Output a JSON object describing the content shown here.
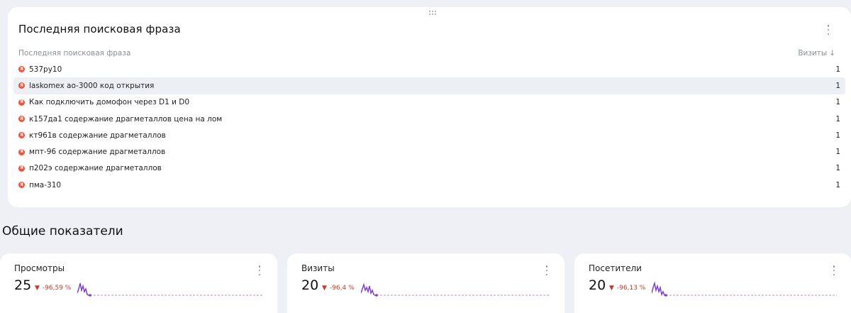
{
  "search_card": {
    "title": "Последняя поисковая фраза",
    "col_phrase": "Последняя поисковая фраза",
    "col_visits": "Визиты",
    "sort_arrow": "↓",
    "source_icon": "yandex-icon",
    "source_icon_letter": "Я",
    "rows": [
      {
        "phrase": "537ру10",
        "visits": "1"
      },
      {
        "phrase": "laskomex ao-3000 код открытия",
        "visits": "1"
      },
      {
        "phrase": "Как подключить домофон через D1 и D0",
        "visits": "1"
      },
      {
        "phrase": "к157да1 содержание драгметаллов цена на лом",
        "visits": "1"
      },
      {
        "phrase": "кт961в содержание драгметаллов",
        "visits": "1"
      },
      {
        "phrase": "мпт-96 содержание драгметаллов",
        "visits": "1"
      },
      {
        "phrase": "п202э содержание драгметаллов",
        "visits": "1"
      },
      {
        "phrase": "пма-310",
        "visits": "1"
      }
    ]
  },
  "section_title": "Общие показатели",
  "metrics": [
    {
      "title": "Просмотры",
      "value": "25",
      "change": "-96,59 %"
    },
    {
      "title": "Визиты",
      "value": "20",
      "change": "-96,4 %"
    },
    {
      "title": "Посетители",
      "value": "20",
      "change": "-96,13 %"
    }
  ],
  "colors": {
    "background": "#eef0f5",
    "card": "#ffffff",
    "negative": "#c53929",
    "spark_line": "#7b3fd1",
    "spark_baseline": "#b48be0",
    "yandex_icon": "#f0533a"
  }
}
